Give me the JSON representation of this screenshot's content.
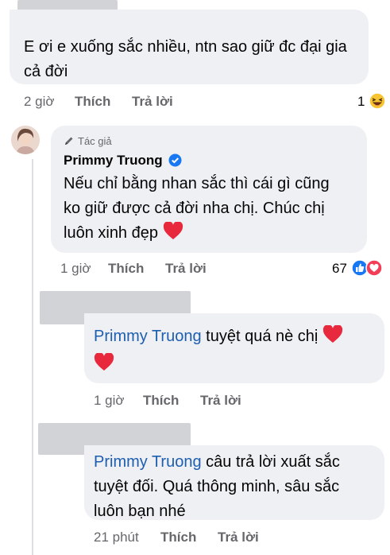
{
  "comment1": {
    "text": "E ơi e xuống sắc nhiều, ntn sao giữ đc đại gia cả đời",
    "time": "2 giờ",
    "like": "Thích",
    "reply": "Trả lời",
    "reaction_count": "1",
    "reaction_icon": "haha-icon"
  },
  "comment2": {
    "badge": "Tác giả",
    "author": "Primmy Truong",
    "text_line1": "Nếu chỉ bằng nhan sắc thì cái gì cũng",
    "text_line2": "ko giữ được cả đời nha chị. Chúc chị",
    "text_line3": "luôn xinh đẹp",
    "time": "1 giờ",
    "like": "Thích",
    "reply": "Trả lời",
    "reaction_count": "67",
    "reaction_icons": [
      "like-icon",
      "love-icon"
    ]
  },
  "reply1": {
    "mention": "Primmy Truong",
    "text": "tuyệt quá nè chị",
    "time": "1 giờ",
    "like": "Thích",
    "reply": "Trả lời"
  },
  "reply2": {
    "mention": "Primmy Truong",
    "text_line1_rest": "câu trả lời xuất sắc",
    "text_line2": "tuyệt đối. Quá thông minh, sâu sắc",
    "text_line3": "luôn bạn nhé",
    "time": "21 phút",
    "like": "Thích",
    "reply": "Trả lời"
  },
  "colors": {
    "bubble": "#eef0f3",
    "mention": "#1e5eb0",
    "meta": "#65676b",
    "verified": "#1877f2",
    "heart": "#e8283d"
  }
}
